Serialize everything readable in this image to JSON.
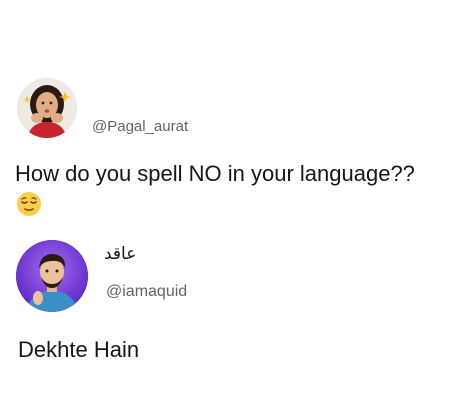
{
  "posts": [
    {
      "handle": "@Pagal_aurat",
      "text": "How do you spell NO in your language??",
      "emoji": "relieved-face-emoji"
    },
    {
      "display_name": "عاقد",
      "handle": "@iamaquid",
      "text": "Dekhte Hain"
    }
  ],
  "colors": {
    "text": "#14171a",
    "handle": "#5b6670",
    "avatar2_bg": "#7b3fe4",
    "emoji_face": "#ffcc4d"
  }
}
